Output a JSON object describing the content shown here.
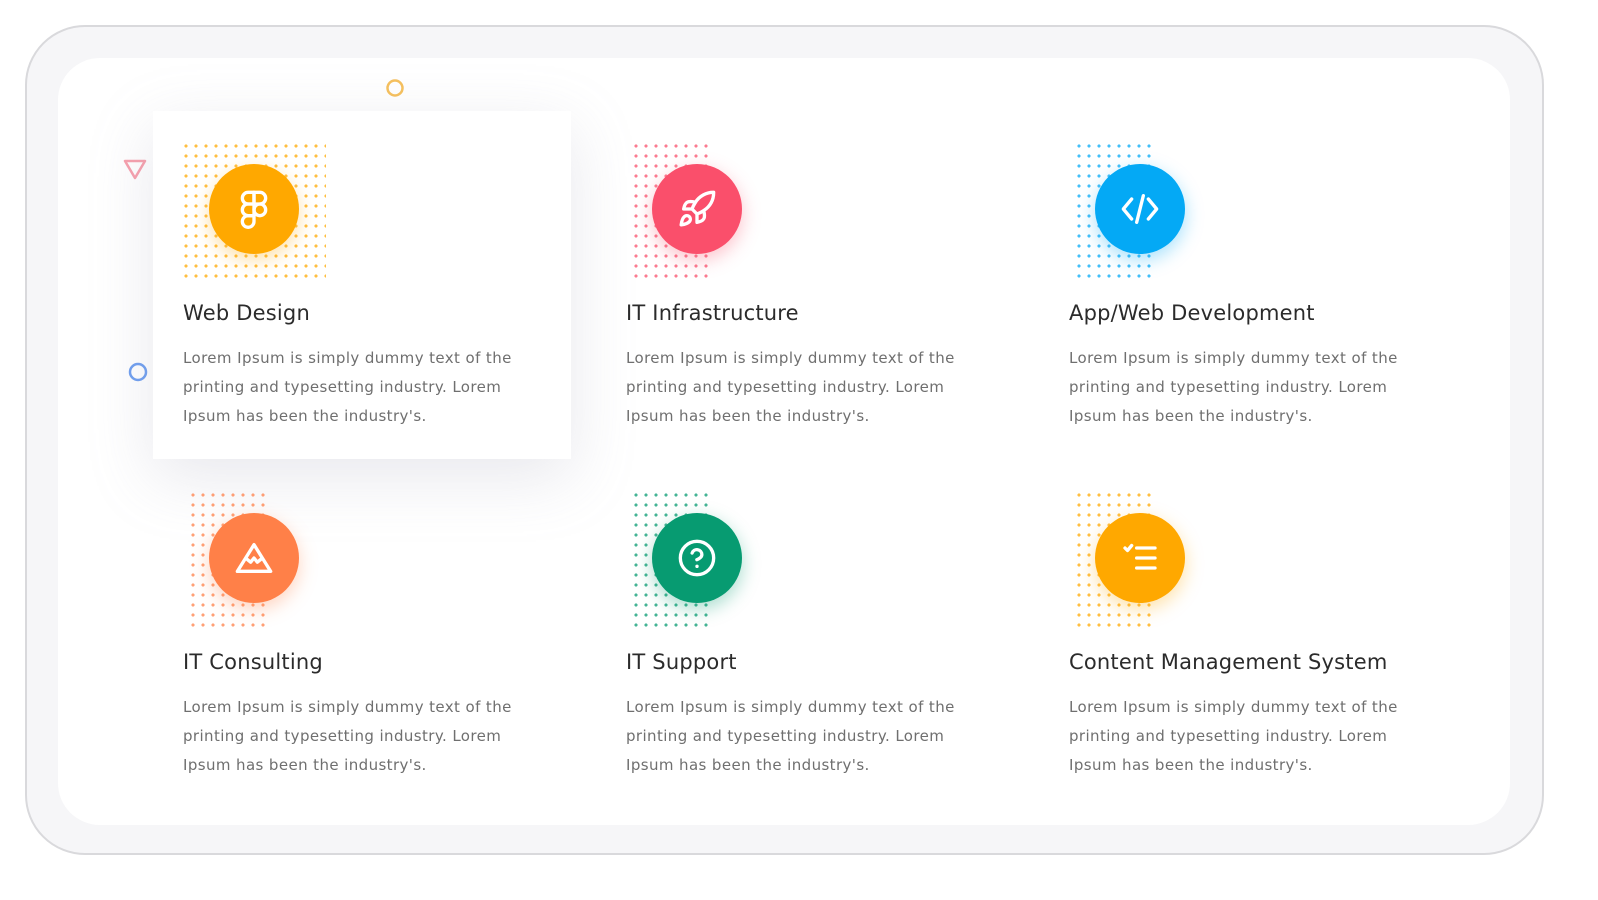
{
  "services": [
    {
      "title": "Web Design",
      "description": "Lorem Ipsum is simply dummy text of the printing and typesetting industry. Lorem Ipsum has been the industry's.",
      "icon": "figma-icon",
      "color": "#ffa800",
      "active": true
    },
    {
      "title": "IT Infrastructure",
      "description": "Lorem Ipsum is simply dummy text of the printing and typesetting industry. Lorem Ipsum has been the industry's.",
      "icon": "rocket-icon",
      "color": "#fa4f6b",
      "active": false
    },
    {
      "title": "App/Web Development",
      "description": "Lorem Ipsum is simply dummy text of the printing and typesetting industry. Lorem Ipsum has been the industry's.",
      "icon": "code-icon",
      "color": "#04a9f5",
      "active": false
    },
    {
      "title": "IT Consulting",
      "description": "Lorem Ipsum is simply dummy text of the printing and typesetting industry. Lorem Ipsum has been the industry's.",
      "icon": "mountain-icon",
      "color": "#ff8048",
      "active": false
    },
    {
      "title": "IT Support",
      "description": "Lorem Ipsum is simply dummy text of the printing and typesetting industry. Lorem Ipsum has been the industry's.",
      "icon": "help-circle-icon",
      "color": "#079b71",
      "active": false
    },
    {
      "title": "Content Management System",
      "description": "Lorem Ipsum is simply dummy text of the printing and typesetting industry. Lorem Ipsum has been the industry's.",
      "icon": "checklist-icon",
      "color": "#ffa800",
      "active": false
    }
  ],
  "decorations": {
    "triangle_color": "#f7a0ad",
    "ring_blue_color": "#6f9ff0",
    "ring_yellow_color": "#f6c15e"
  }
}
